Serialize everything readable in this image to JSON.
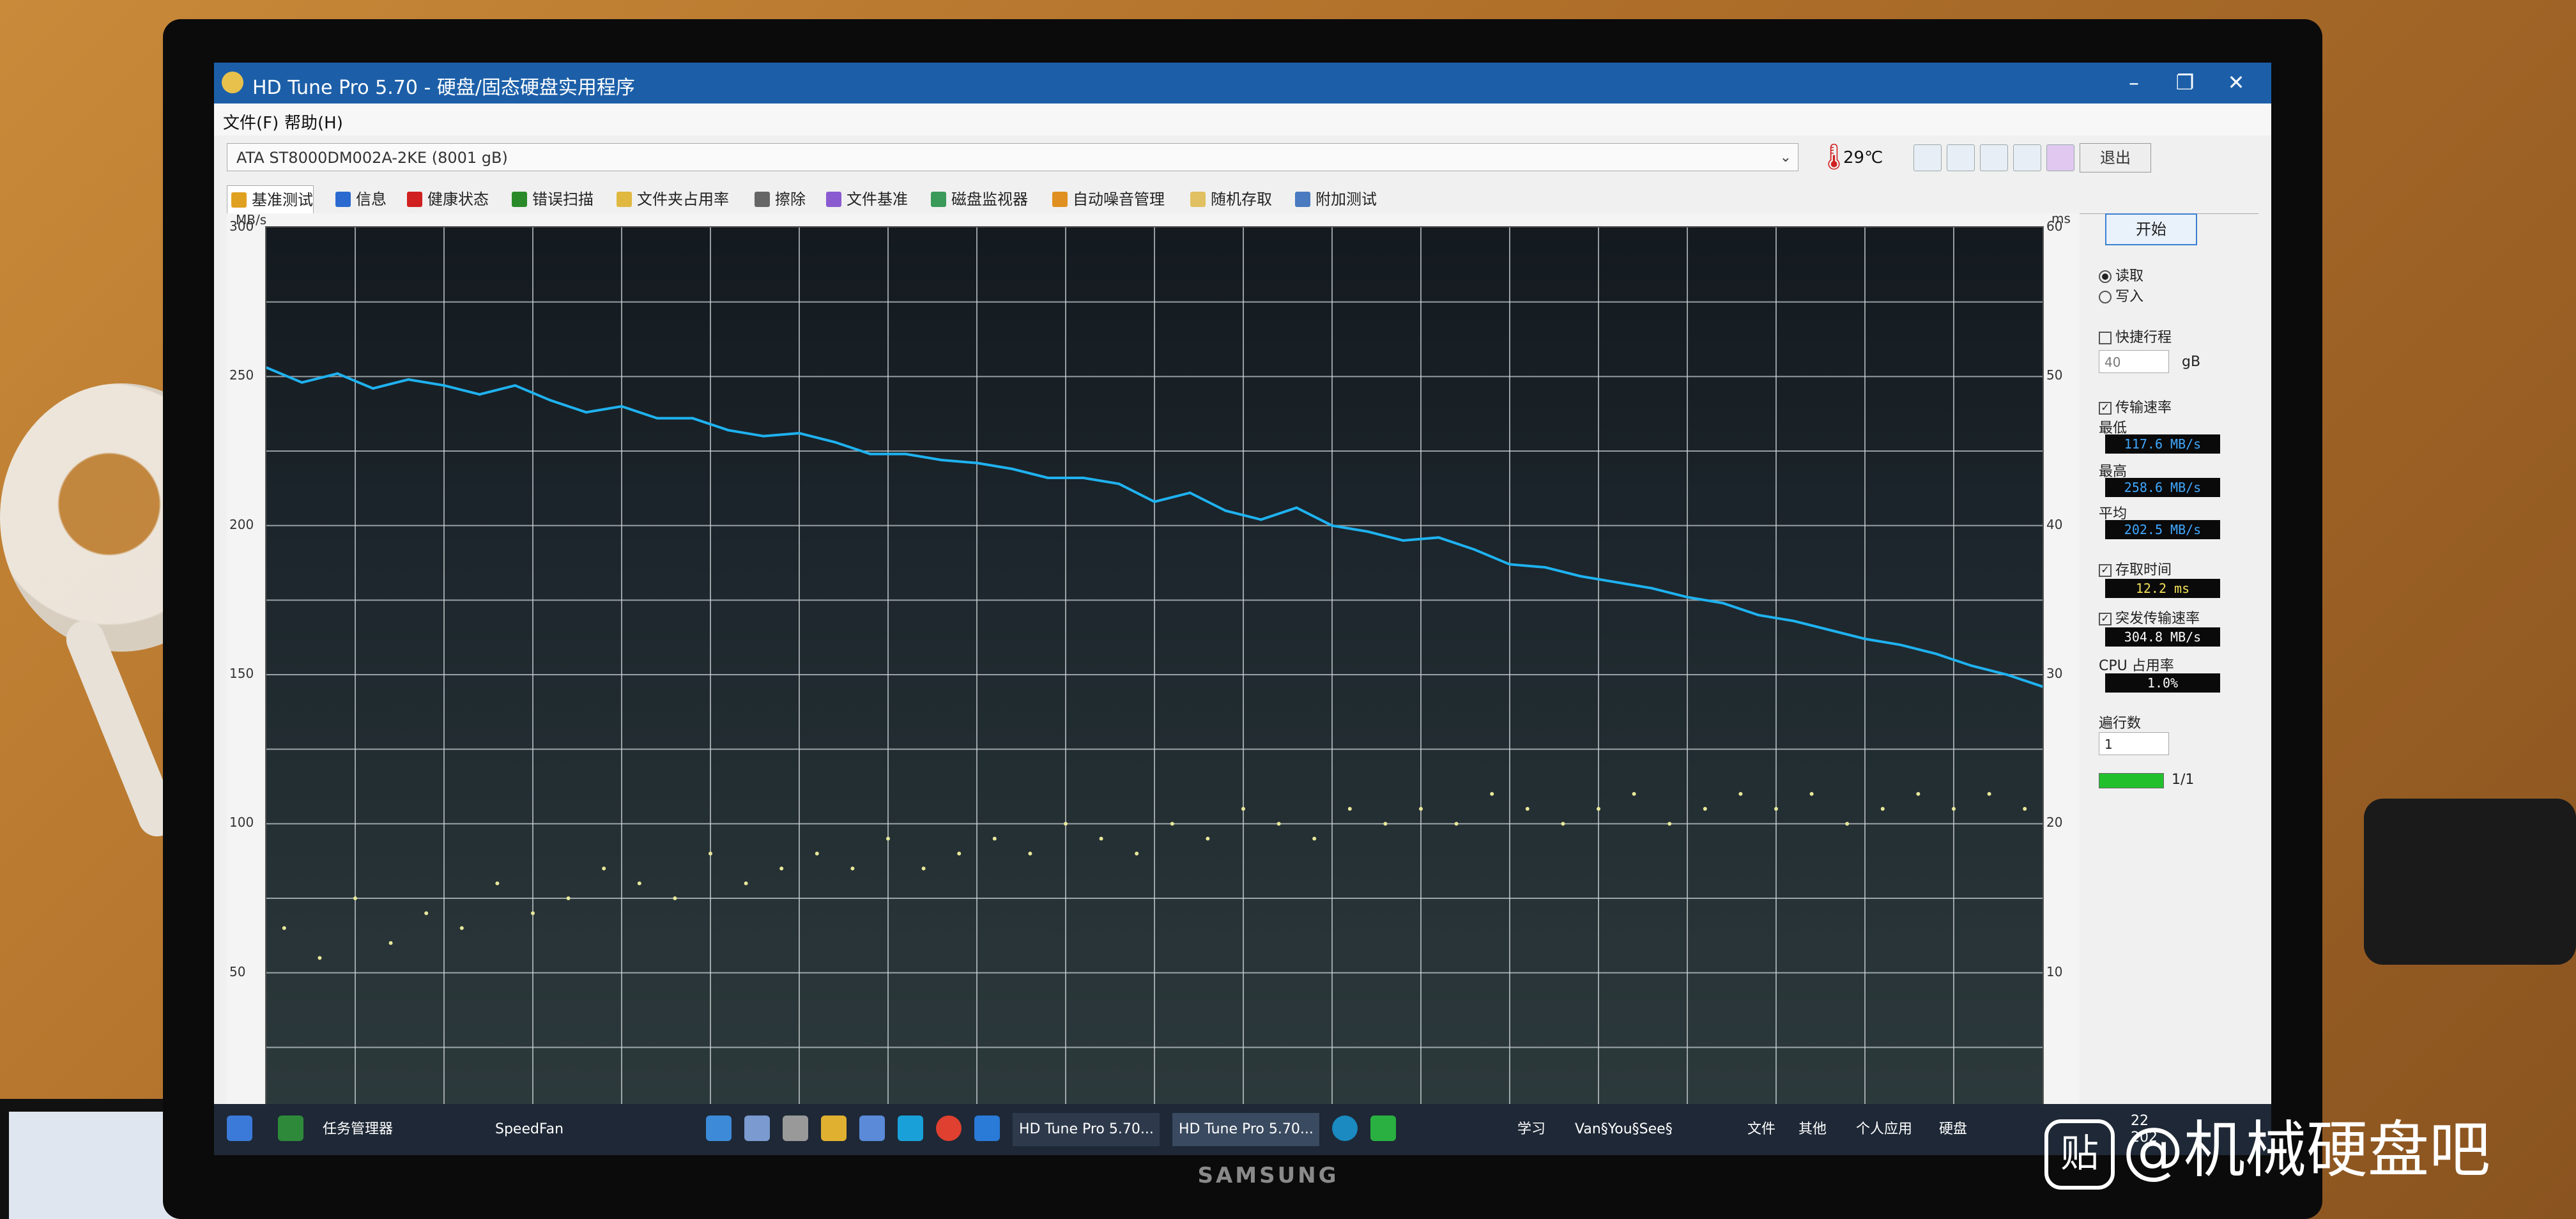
{
  "window": {
    "title": "HD Tune Pro 5.70 - 硬盘/固态硬盘实用程序",
    "controls": [
      "–",
      "❐",
      "✕"
    ]
  },
  "menu": [
    "文件(F)",
    "帮助(H)"
  ],
  "device": {
    "selected": "ATA     ST8000DM002A-2KE (8001 gB)",
    "temperature": "29℃",
    "exit_label": "退出"
  },
  "tabs": [
    {
      "label": "基准测试",
      "icon": "benchmark-icon",
      "color": "#e0a020"
    },
    {
      "label": "信息",
      "icon": "info-icon",
      "color": "#2a6ad0"
    },
    {
      "label": "健康状态",
      "icon": "health-icon",
      "color": "#d02020"
    },
    {
      "label": "错误扫描",
      "icon": "error-scan-icon",
      "color": "#2a8a2a"
    },
    {
      "label": "文件夹占用率",
      "icon": "folder-icon",
      "color": "#e0b840"
    },
    {
      "label": "擦除",
      "icon": "erase-icon",
      "color": "#666666"
    },
    {
      "label": "文件基准",
      "icon": "file-benchmark-icon",
      "color": "#8a5ad0"
    },
    {
      "label": "磁盘监视器",
      "icon": "disk-monitor-icon",
      "color": "#3a9a5a"
    },
    {
      "label": "自动噪音管理",
      "icon": "noise-icon",
      "color": "#e09020"
    },
    {
      "label": "随机存取",
      "icon": "random-access-icon",
      "color": "#e0c060"
    },
    {
      "label": "附加测试",
      "icon": "extra-test-icon",
      "color": "#4a7ac0"
    }
  ],
  "graph": {
    "left_unit": "MB/s",
    "right_unit": "ms",
    "left_ticks": [
      "300",
      "250",
      "200",
      "150",
      "100",
      "50"
    ],
    "right_ticks": [
      "60",
      "50",
      "40",
      "30",
      "20",
      "10"
    ]
  },
  "chart_data": {
    "type": "line",
    "title": "",
    "xlabel": "",
    "ylabel": "MB/s",
    "y2label": "ms",
    "ylim": [
      0,
      300
    ],
    "y2lim": [
      0,
      60
    ],
    "xlim": [
      0,
      100
    ],
    "grid": true,
    "series": [
      {
        "name": "",
        "color": "#1fb2f0",
        "axis": "left",
        "x": [
          0,
          2,
          4,
          6,
          8,
          10,
          12,
          14,
          16,
          18,
          20,
          22,
          24,
          26,
          28,
          30,
          32,
          34,
          36,
          38,
          40,
          42,
          44,
          46,
          48,
          50,
          52,
          54,
          56,
          58,
          60,
          62,
          64,
          66,
          68,
          70,
          72,
          74,
          76,
          78,
          80,
          82,
          84,
          86,
          88,
          90,
          92,
          94,
          96,
          98,
          100
        ],
        "values": [
          253,
          248,
          251,
          246,
          249,
          247,
          244,
          247,
          242,
          238,
          240,
          236,
          236,
          232,
          230,
          231,
          228,
          224,
          224,
          222,
          221,
          219,
          216,
          216,
          214,
          208,
          211,
          205,
          202,
          206,
          200,
          198,
          195,
          196,
          192,
          187,
          186,
          183,
          181,
          179,
          176,
          174,
          170,
          168,
          165,
          162,
          160,
          157,
          153,
          150,
          146
        ]
      },
      {
        "name": "",
        "color": "#e8e89a",
        "axis": "right",
        "style": "scatter",
        "x": [
          1,
          3,
          5,
          7,
          9,
          11,
          13,
          15,
          17,
          19,
          21,
          23,
          25,
          27,
          29,
          31,
          33,
          35,
          37,
          39,
          41,
          43,
          45,
          47,
          49,
          51,
          53,
          55,
          57,
          59,
          61,
          63,
          65,
          67,
          69,
          71,
          73,
          75,
          77,
          79,
          81,
          83,
          85,
          87,
          89,
          91,
          93,
          95,
          97,
          99
        ],
        "values": [
          13,
          11,
          15,
          12,
          14,
          13,
          16,
          14,
          15,
          17,
          16,
          15,
          18,
          16,
          17,
          18,
          17,
          19,
          17,
          18,
          19,
          18,
          20,
          19,
          18,
          20,
          19,
          21,
          20,
          19,
          21,
          20,
          21,
          20,
          22,
          21,
          20,
          21,
          22,
          20,
          21,
          22,
          21,
          22,
          20,
          21,
          22,
          21,
          22,
          21
        ]
      }
    ]
  },
  "side": {
    "start_label": "开始",
    "read_label": "读取",
    "write_label": "写入",
    "quick_label": "快捷行程",
    "quick_value": "40",
    "quick_unit": "gB",
    "transfer_label": "传输速率",
    "min_label": "最低",
    "min_value": "117.6 MB/s",
    "max_label": "最高",
    "max_value": "258.6 MB/s",
    "avg_label": "平均",
    "avg_value": "202.5 MB/s",
    "access_label": "存取时间",
    "access_value": "12.2 ms",
    "burst_label": "突发传输速率",
    "burst_value": "304.8 MB/s",
    "cpu_label": "CPU 占用率",
    "cpu_value": "1.0%",
    "pass_label": "遍行数",
    "pass_value": "1",
    "progress_fraction": 1.0,
    "progress_text": "1/1"
  },
  "taskbar": {
    "items": [
      {
        "label": "任务管理器"
      },
      {
        "label": "SpeedFan"
      },
      {
        "label": "HD Tune Pro 5.70..."
      },
      {
        "label": "HD Tune Pro 5.70..."
      }
    ],
    "tray": [
      "学习",
      "Van§You§See§",
      "文件",
      "其他",
      "个人应用",
      "硬盘"
    ],
    "time": "22",
    "date": "202"
  },
  "bezel_brand": "SAMSUNG",
  "watermark": {
    "logo_text": "贴",
    "text": "@机械硬盘吧"
  }
}
